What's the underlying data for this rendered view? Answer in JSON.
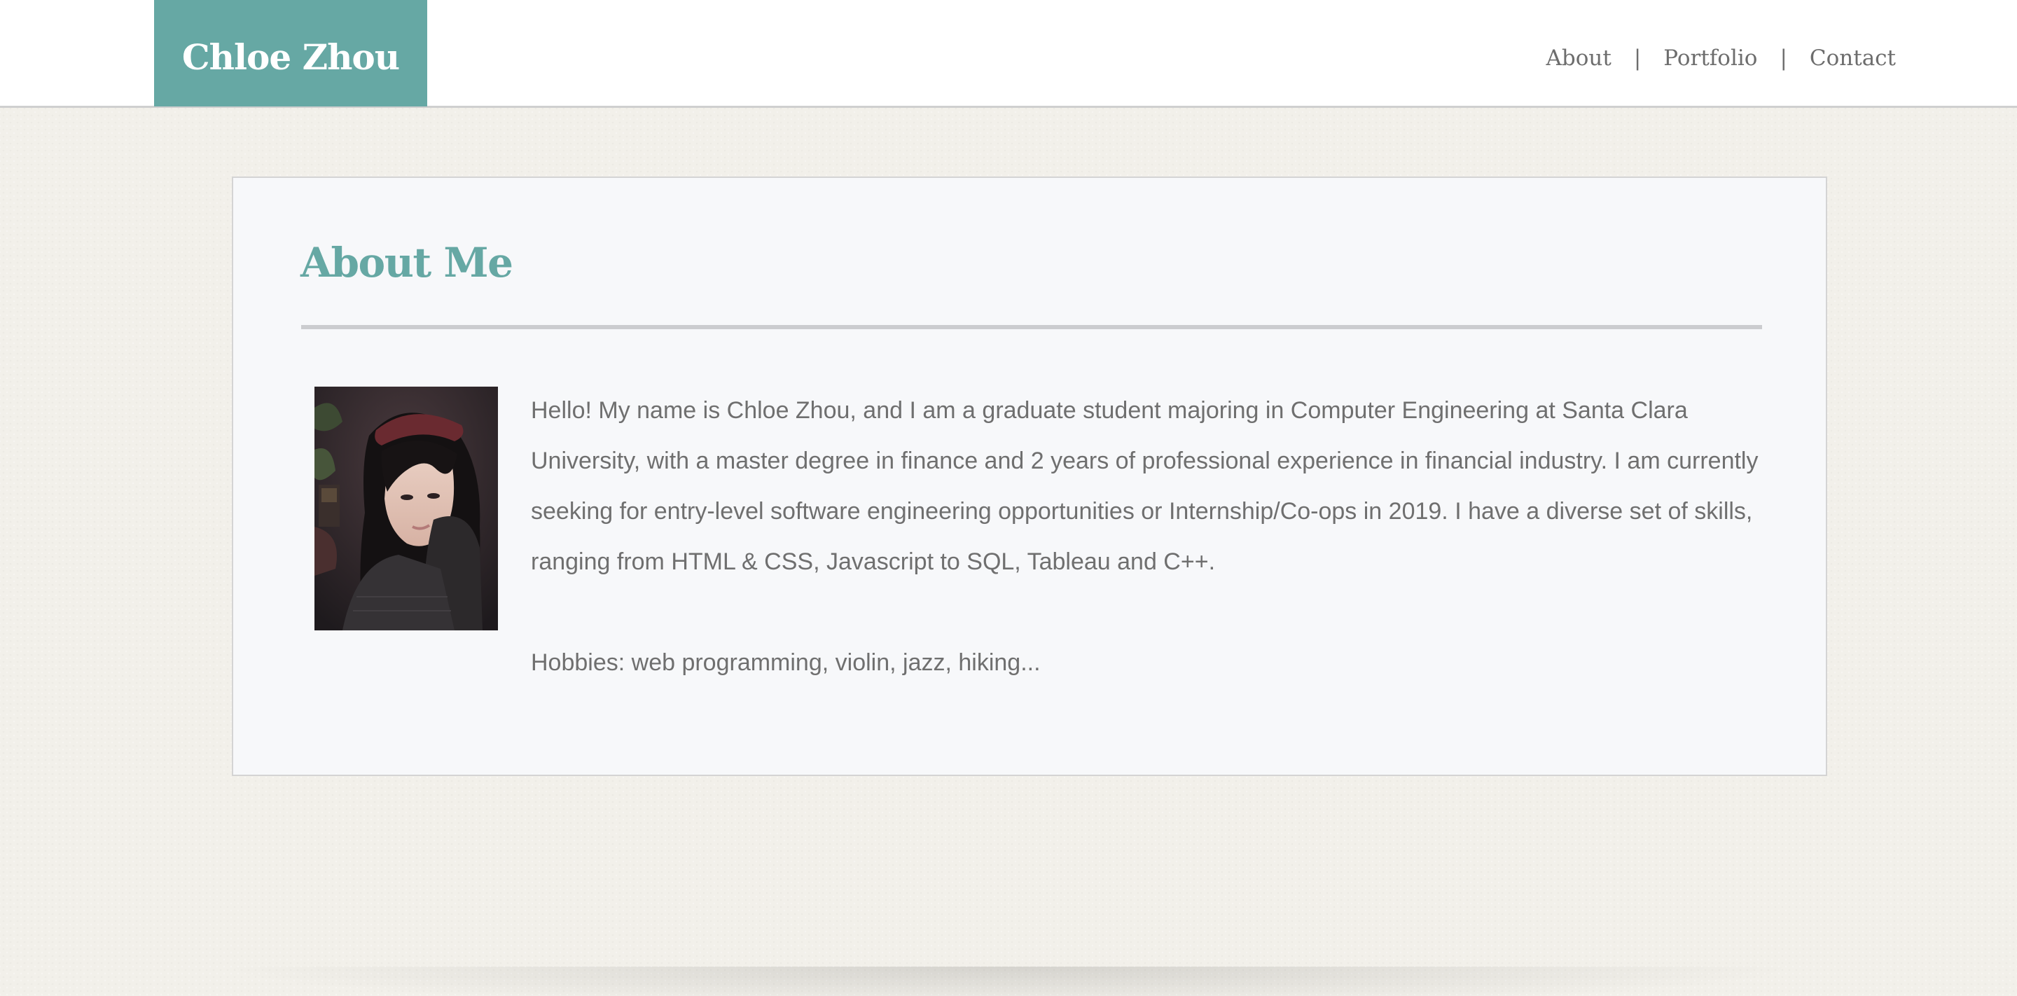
{
  "header": {
    "logo": "Chloe Zhou",
    "nav": [
      {
        "label": "About"
      },
      {
        "label": "Portfolio"
      },
      {
        "label": "Contact"
      }
    ],
    "separator": "|"
  },
  "about": {
    "title": "About Me",
    "photo_icon": "portrait-photo",
    "bio": "Hello! My name is Chloe Zhou, and I am a graduate student majoring in Computer Engineering at Santa Clara University, with a master degree in finance and 2 years of professional experience in financial industry. I am currently seeking for entry-level software engineering opportunities or Internship/Co-ops in 2019. I have a diverse set of skills, ranging from HTML & CSS, Javascript to SQL, Tableau and C++.",
    "hobbies": "Hobbies: web programming, violin, jazz, hiking..."
  },
  "colors": {
    "accent": "#66a8a4",
    "background": "#f2f0ea",
    "card": "#f7f8fa",
    "text": "#6f6f6f"
  }
}
